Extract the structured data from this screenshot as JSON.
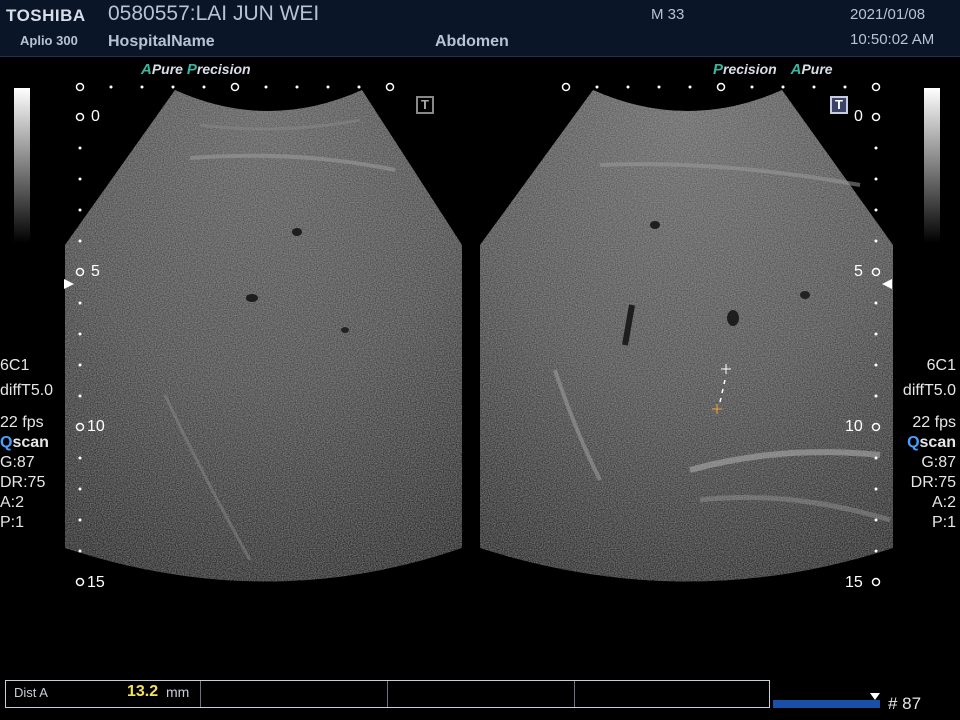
{
  "header": {
    "brand": "TOSHIBA",
    "model": "Aplio 300",
    "patient": "0580557:LAI JUN WEI",
    "hospital": "HospitalName",
    "exam": "Abdomen",
    "mi": "M 33",
    "date": "2021/01/08",
    "time": "10:50:02 AM"
  },
  "left_panel": {
    "tags_a": "A",
    "tags_pure": "Pure",
    "tags_p": "P",
    "tags_precision": "recision",
    "t_mark": "T",
    "depth": [
      "0",
      "5",
      "10",
      "15"
    ],
    "params": {
      "probe": "6C1",
      "mode": "diffT5.0",
      "fps": "22 fps",
      "scan_q": "Q",
      "scan_rest": "scan",
      "gain": "G:87",
      "dr": "DR:75",
      "a": "A:2",
      "p": "P:1"
    }
  },
  "right_panel": {
    "tags_p": "P",
    "tags_precision": "recision",
    "tags_a": "A",
    "tags_pure": "Pure",
    "t_mark": "T",
    "depth": [
      "0",
      "5",
      "10",
      "15"
    ],
    "params": {
      "probe": "6C1",
      "mode": "diffT5.0",
      "fps": "22 fps",
      "scan_q": "Q",
      "scan_rest": "scan",
      "gain": "G:87",
      "dr": "DR:75",
      "a": "A:2",
      "p": "P:1"
    }
  },
  "measurement": {
    "label": "Dist A",
    "value": "13.2",
    "unit": "mm"
  },
  "cine": {
    "frame": "# 87"
  },
  "colors": {
    "header_bg": "#0a1628",
    "text": "#b8c2d6",
    "accent_teal": "#3ab7a2",
    "measurement_value": "#f3e25a",
    "scan_q": "#4aa0ff",
    "progress": "#1a4fa8"
  }
}
